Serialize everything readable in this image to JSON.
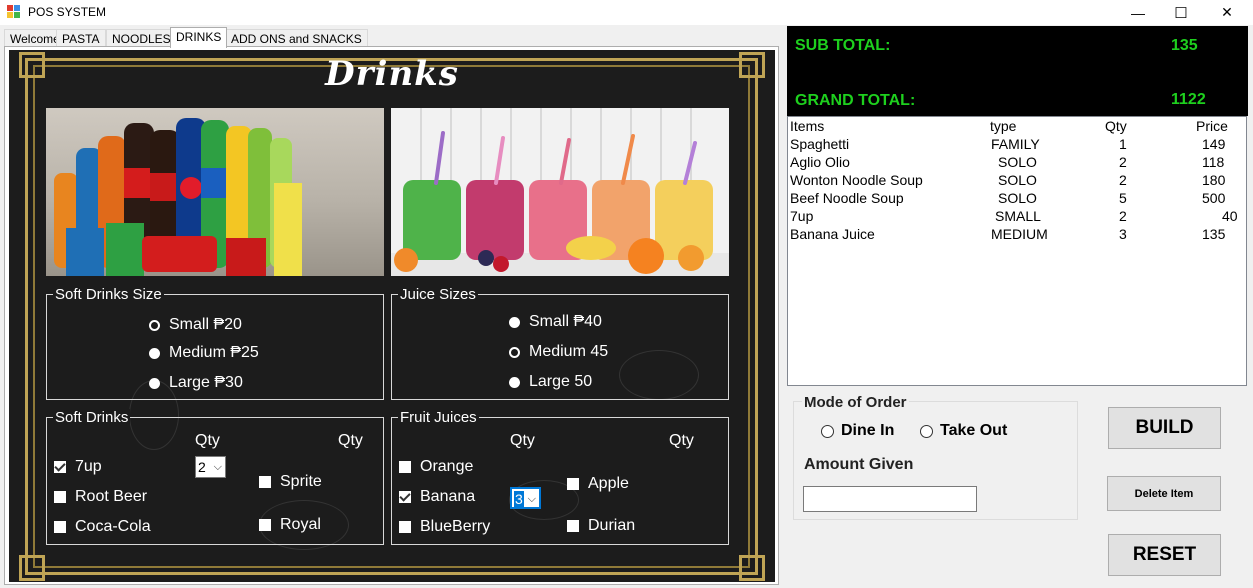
{
  "window": {
    "title": "POS SYSTEM",
    "minimize": "—",
    "maximize": "☐",
    "close": "✕"
  },
  "tabs": [
    "Welcome",
    "PASTA",
    "NOODLES",
    "DRINKS",
    "ADD ONS and SNACKS"
  ],
  "active_tab": "DRINKS",
  "heading": "Drinks",
  "soft_size": {
    "title": "Soft Drinks Size",
    "options": [
      {
        "label": "Small  ₱20",
        "selected": false
      },
      {
        "label": "Medium  ₱25",
        "selected": true
      },
      {
        "label": "Large  ₱30",
        "selected": true
      }
    ]
  },
  "juice_size": {
    "title": "Juice Sizes",
    "options": [
      {
        "label": "Small  ₱40",
        "selected": true
      },
      {
        "label": "Medium 45",
        "selected": false
      },
      {
        "label": "Large 50",
        "selected": true
      }
    ]
  },
  "soft_drinks": {
    "title": "Soft Drinks",
    "qty_label": "Qty",
    "items": [
      {
        "label": "7up",
        "checked": true
      },
      {
        "label": "Root Beer",
        "checked": false
      },
      {
        "label": "Coca-Cola",
        "checked": false
      },
      {
        "label": "Sprite",
        "checked": false
      },
      {
        "label": "Royal",
        "checked": false
      }
    ],
    "qty_value": "2"
  },
  "fruit_juices": {
    "title": "Fruit Juices",
    "qty_label": "Qty",
    "items": [
      {
        "label": "Orange",
        "checked": false
      },
      {
        "label": "Banana",
        "checked": true
      },
      {
        "label": "BlueBerry",
        "checked": false
      },
      {
        "label": "Apple",
        "checked": false
      },
      {
        "label": "Durian",
        "checked": false
      }
    ],
    "qty_value": "3"
  },
  "totals": {
    "sub_label": "SUB TOTAL:",
    "sub_value": "135",
    "grand_label": "GRAND TOTAL:",
    "grand_value": "1122"
  },
  "order_list": {
    "headers": [
      "Items",
      "type",
      "Qty",
      "Price"
    ],
    "rows": [
      [
        "Spaghetti",
        "FAMILY",
        "1",
        "149"
      ],
      [
        "Aglio Olio",
        "SOLO",
        "2",
        "118"
      ],
      [
        "Wonton Noodle Soup",
        "SOLO",
        "2",
        "180"
      ],
      [
        "Beef Noodle Soup",
        "SOLO",
        "5",
        "500"
      ],
      [
        "7up",
        "SMALL",
        "2",
        "40"
      ],
      [
        "Banana Juice",
        "MEDIUM",
        "3",
        "135"
      ]
    ]
  },
  "mode": {
    "title": "Mode of Order",
    "dine_in": "Dine In",
    "take_out": "Take Out",
    "amount_label": "Amount Given",
    "amount_value": ""
  },
  "buttons": {
    "build": "BUILD",
    "delete": "Delete Item",
    "reset": "RESET"
  },
  "colors": {
    "total_text": "#1ed01e",
    "board": "#1c1c1c",
    "gold": "#bfa455"
  }
}
